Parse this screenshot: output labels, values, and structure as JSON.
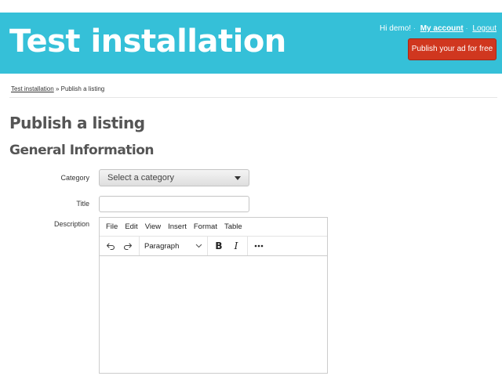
{
  "header": {
    "site_title": "Test installation",
    "greeting": "Hi demo!",
    "separator": "·",
    "my_account": "My account",
    "logout": "Logout",
    "publish_button": "Publish your ad for free",
    "background_color": "#35c0d8",
    "button_color": "#d0371f"
  },
  "breadcrumb": {
    "home": "Test installation",
    "separator": "»",
    "current": "Publish a listing"
  },
  "page": {
    "title": "Publish a listing",
    "section_title": "General Information"
  },
  "form": {
    "category_label": "Category",
    "category_selected": "Select a category",
    "title_label": "Title",
    "title_value": "",
    "description_label": "Description"
  },
  "editor": {
    "menu": [
      "File",
      "Edit",
      "View",
      "Insert",
      "Format",
      "Table"
    ],
    "toolbar": {
      "undo_icon": "undo-icon",
      "redo_icon": "redo-icon",
      "block_format": "Paragraph",
      "bold": "B",
      "italic": "I",
      "more_icon": "more-icon"
    }
  }
}
